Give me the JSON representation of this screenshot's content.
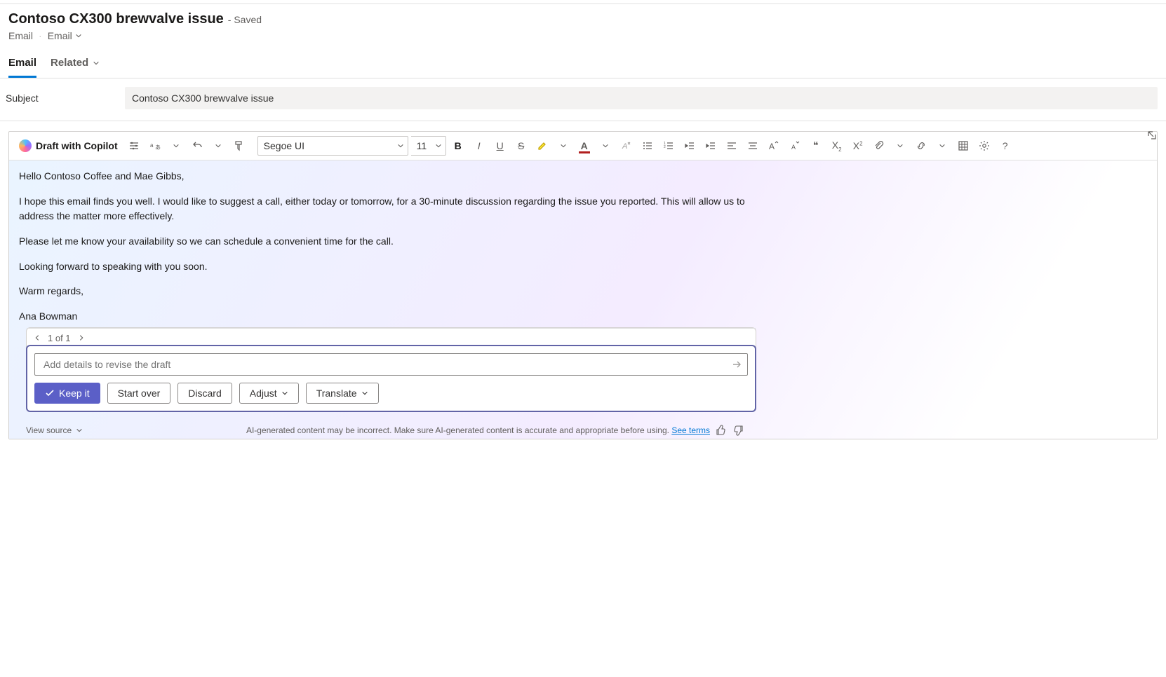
{
  "header": {
    "title": "Contoso CX300 brewvalve issue",
    "save_state": "- Saved",
    "breadcrumb_root": "Email",
    "breadcrumb_item": "Email"
  },
  "tabs": {
    "email": "Email",
    "related": "Related"
  },
  "subject": {
    "label": "Subject",
    "value": "Contoso CX300 brewvalve issue"
  },
  "toolbar": {
    "draft_with_copilot": "Draft with Copilot",
    "font_name": "Segoe UI",
    "font_size": "11"
  },
  "draft": {
    "p1": "Hello Contoso Coffee and Mae Gibbs,",
    "p2": "I hope this email finds you well. I would like to suggest a call, either today or tomorrow, for a 30-minute discussion regarding the issue you reported. This will allow us to address the matter more effectively.",
    "p3": "Please let me know your availability so we can schedule a convenient time for the call.",
    "p4": "Looking forward to speaking with you soon.",
    "p5": "Warm regards,",
    "p6": "Ana Bowman"
  },
  "pager": {
    "text": "1 of 1"
  },
  "revise": {
    "placeholder": "Add details to revise the draft"
  },
  "actions": {
    "keep": "Keep it",
    "start_over": "Start over",
    "discard": "Discard",
    "adjust": "Adjust",
    "translate": "Translate"
  },
  "footer": {
    "view_source": "View source",
    "disclaimer": "AI-generated content may be incorrect. Make sure AI-generated content is accurate and appropriate before using. ",
    "see_terms": "See terms"
  }
}
